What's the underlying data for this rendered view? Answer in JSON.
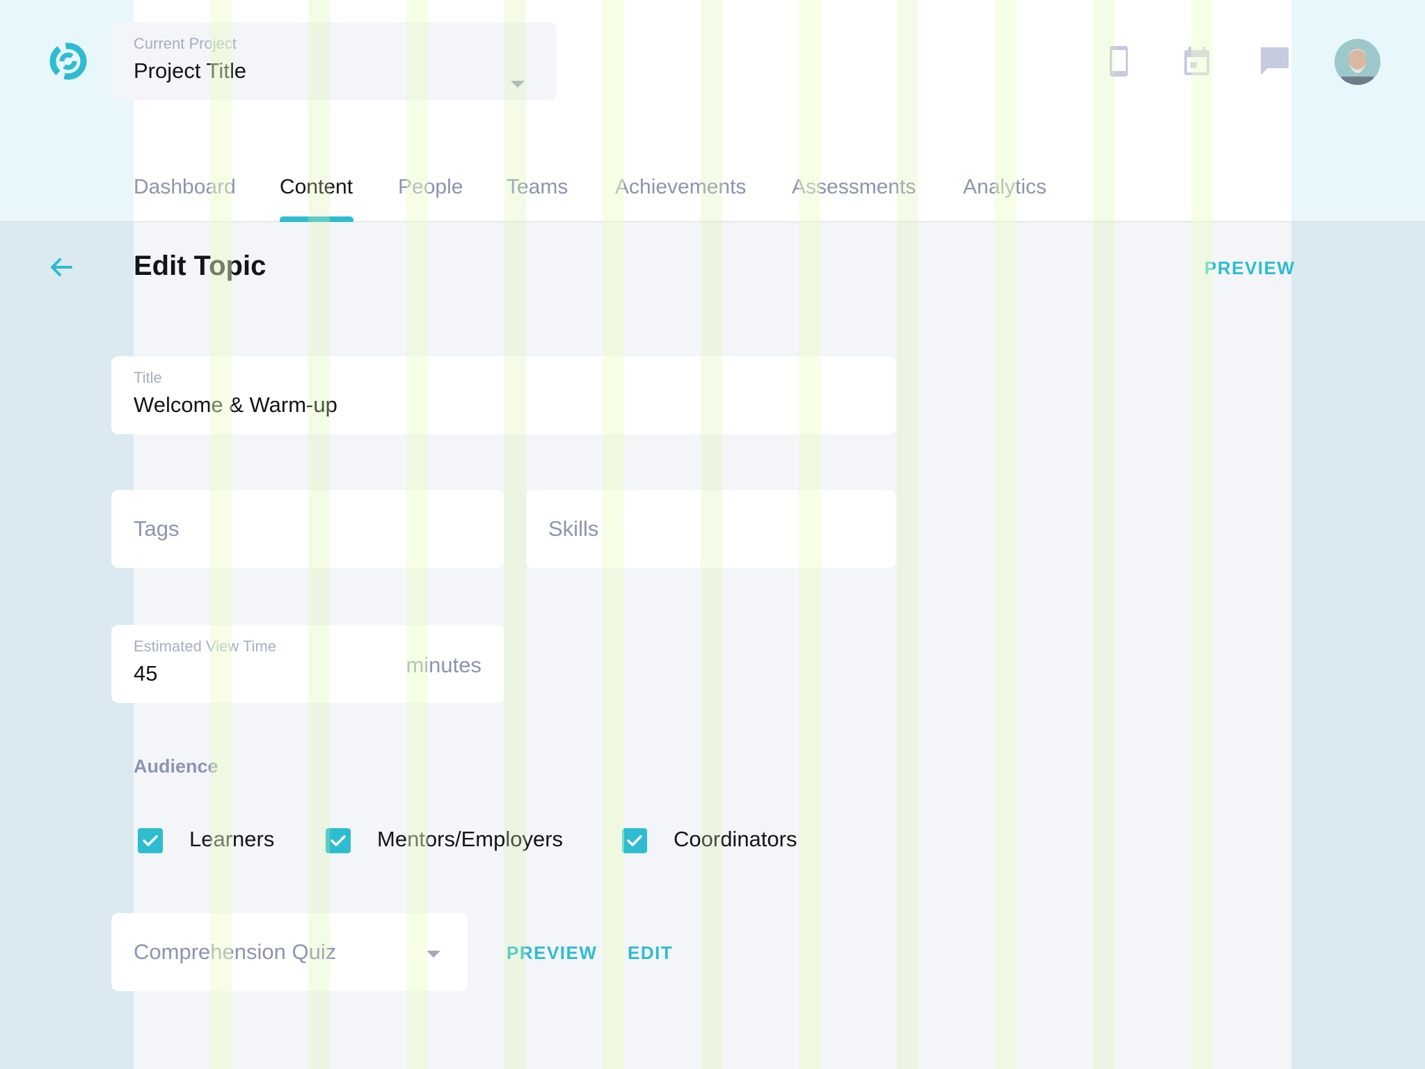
{
  "colors": {
    "accent": "#2ebcd0",
    "text_primary": "#111418",
    "text_muted": "#8c94b0",
    "label_muted": "#a6aec4",
    "icon_muted": "#c7cbe0"
  },
  "header": {
    "logo_icon": "swirl-logo-icon",
    "project_select": {
      "label": "Current Project",
      "value": "Project Title"
    },
    "icons": [
      "mobile-icon",
      "calendar-icon",
      "chat-icon"
    ],
    "avatar_icon": "user-avatar"
  },
  "tabs": [
    {
      "label": "Dashboard",
      "active": false
    },
    {
      "label": "Content",
      "active": true
    },
    {
      "label": "People",
      "active": false
    },
    {
      "label": "Teams",
      "active": false
    },
    {
      "label": "Achievements",
      "active": false
    },
    {
      "label": "Assessments",
      "active": false
    },
    {
      "label": "Analytics",
      "active": false
    }
  ],
  "page": {
    "title": "Edit Topic",
    "preview_label": "PREVIEW"
  },
  "form": {
    "title": {
      "label": "Title",
      "value": "Welcome & Warm-up"
    },
    "tags": {
      "placeholder": "Tags"
    },
    "skills": {
      "placeholder": "Skills"
    },
    "view_time": {
      "label": "Estimated View Time",
      "value": "45",
      "suffix": "minutes"
    },
    "audience": {
      "label": "Audience",
      "options": [
        {
          "label": "Learners",
          "checked": true
        },
        {
          "label": "Mentors/Employers",
          "checked": true
        },
        {
          "label": "Coordinators",
          "checked": true
        }
      ]
    },
    "quiz": {
      "placeholder": "Comprehension Quiz",
      "preview_label": "PREVIEW",
      "edit_label": "EDIT"
    }
  }
}
